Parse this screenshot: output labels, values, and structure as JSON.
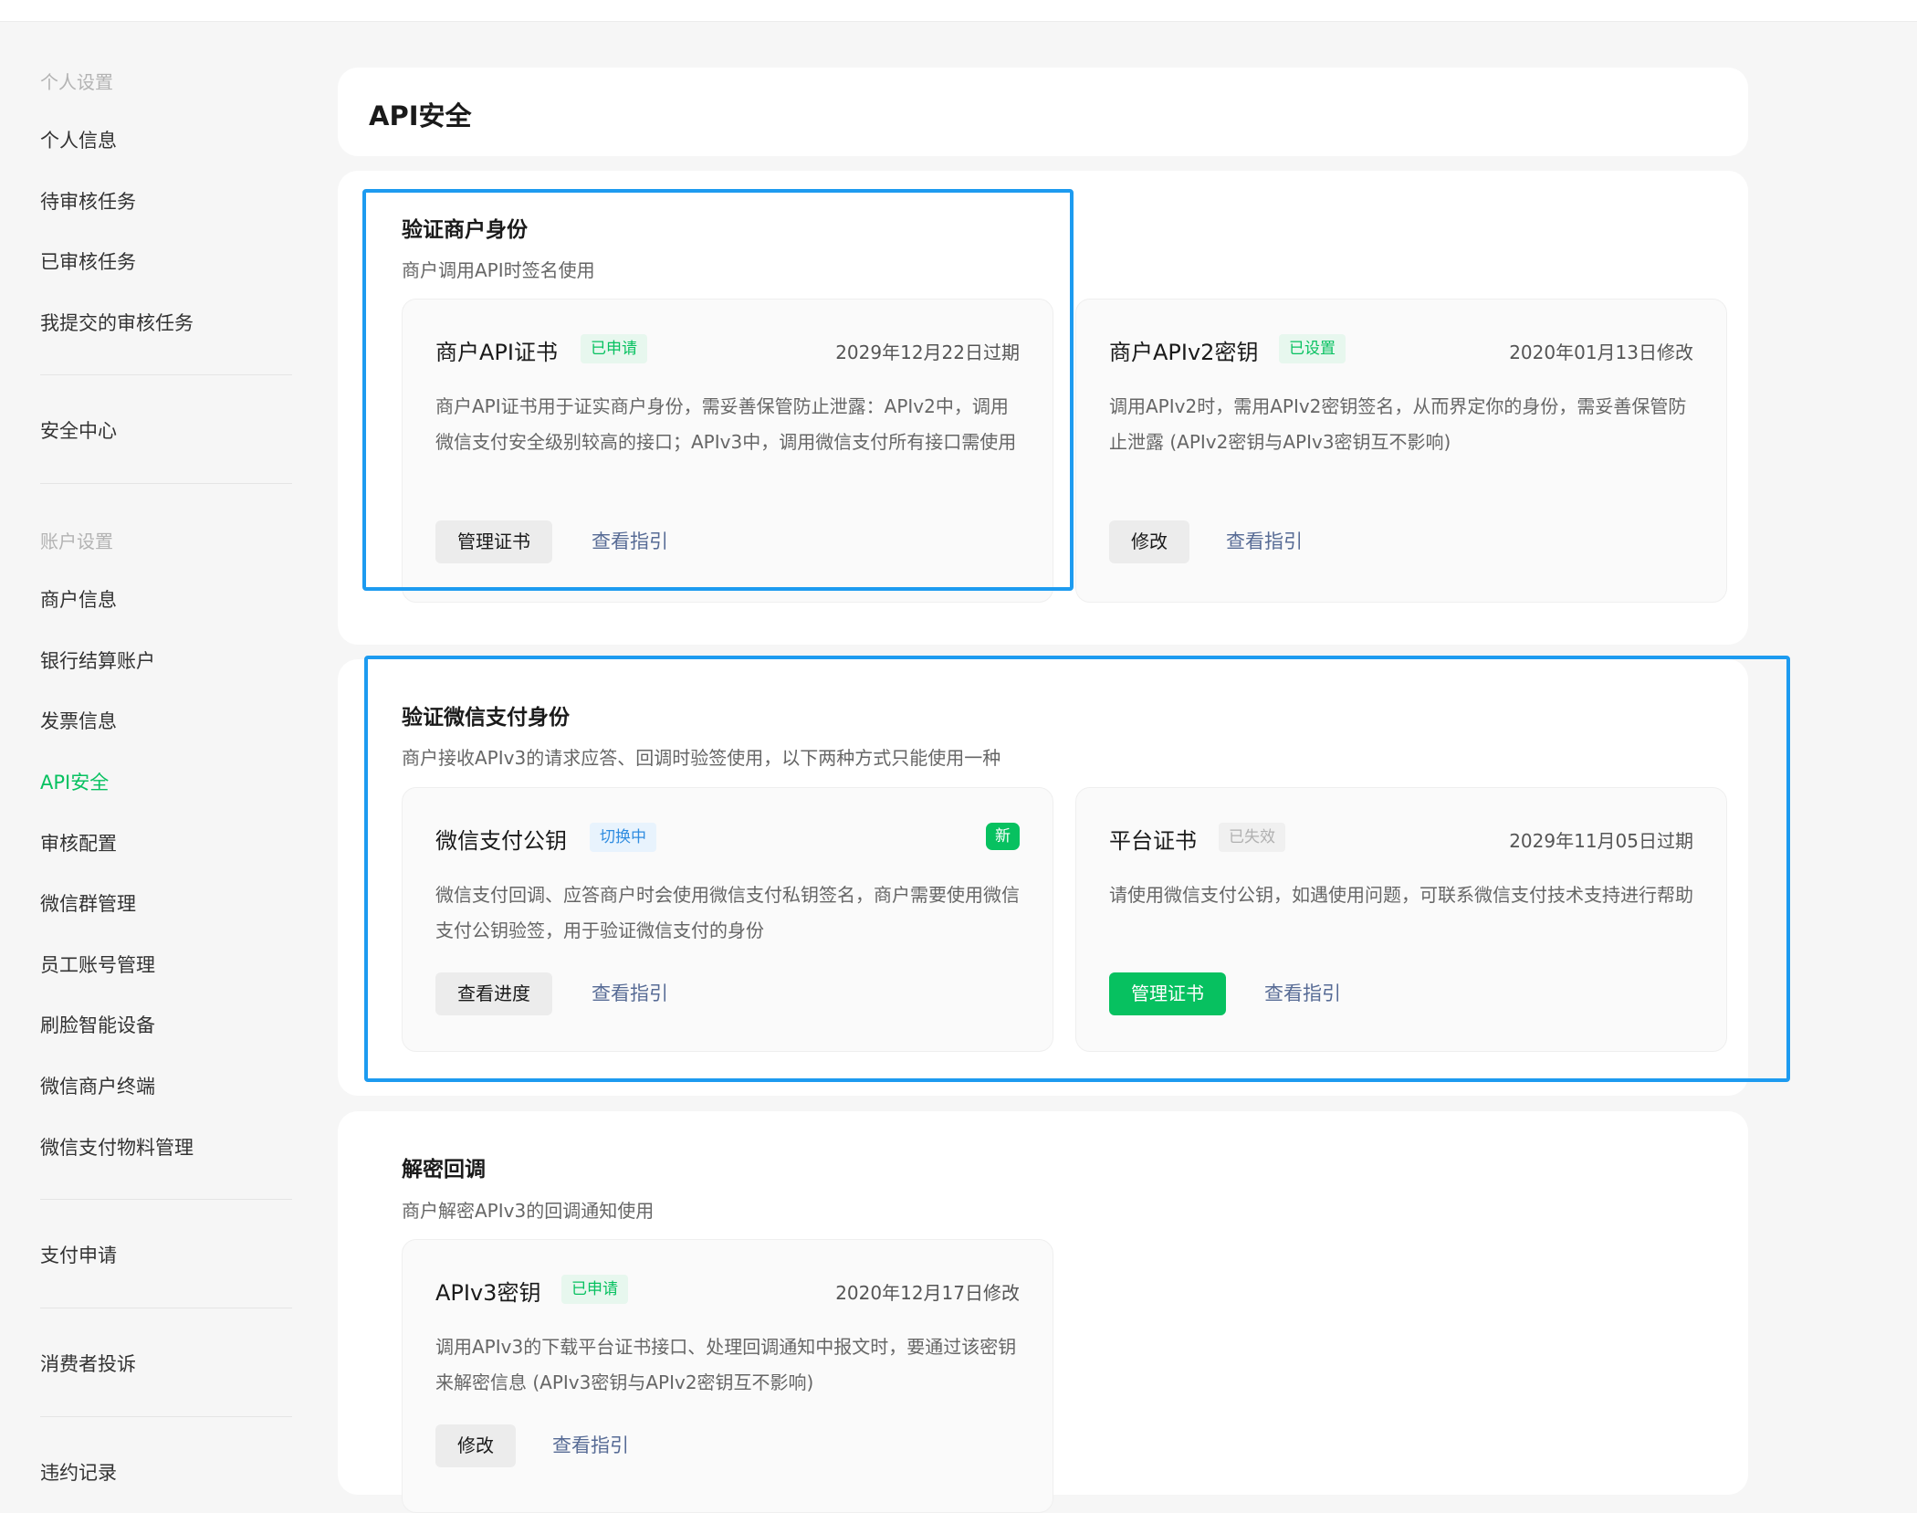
{
  "sidebar": {
    "sections": [
      {
        "title": "个人设置",
        "items": [
          "个人信息",
          "待审核任务",
          "已审核任务",
          "我提交的审核任务"
        ]
      },
      {
        "items": [
          "安全中心"
        ]
      },
      {
        "title": "账户设置",
        "items": [
          "商户信息",
          "银行结算账户",
          "发票信息",
          "API安全",
          "审核配置",
          "微信群管理",
          "员工账号管理",
          "刷脸智能设备",
          "微信商户终端",
          "微信支付物料管理"
        ]
      },
      {
        "items": [
          "支付申请"
        ]
      },
      {
        "items": [
          "消费者投诉"
        ]
      },
      {
        "items": [
          "违约记录"
        ]
      }
    ],
    "active_item": "API安全"
  },
  "page": {
    "title": "API安全"
  },
  "merchant_identity": {
    "title": "验证商户身份",
    "subtitle": "商户调用API时签名使用",
    "cards": [
      {
        "title": "商户API证书",
        "tag": "已申请",
        "meta": "2029年12月22日过期",
        "desc": "商户API证书用于证实商户身份，需妥善保管防止泄露：APIv2中，调用微信支付安全级别较高的接口；APIv3中，调用微信支付所有接口需使用",
        "button": "管理证书",
        "link": "查看指引"
      },
      {
        "title": "商户APIv2密钥",
        "tag": "已设置",
        "meta": "2020年01月13日修改",
        "desc": "调用APIv2时，需用APIv2密钥签名，从而界定你的身份，需妥善保管防止泄露 (APIv2密钥与APIv3密钥互不影响)",
        "button": "修改",
        "link": "查看指引"
      }
    ]
  },
  "wechatpay_identity": {
    "title": "验证微信支付身份",
    "subtitle": "商户接收APIv3的请求应答、回调时验签使用，以下两种方式只能使用一种",
    "cards": [
      {
        "title": "微信支付公钥",
        "tag": "切换中",
        "badge": "新",
        "desc": "微信支付回调、应答商户时会使用微信支付私钥签名，商户需要使用微信支付公钥验签，用于验证微信支付的身份",
        "button": "查看进度",
        "link": "查看指引"
      },
      {
        "title": "平台证书",
        "tag": "已失效",
        "meta": "2029年11月05日过期",
        "desc": "请使用微信支付公钥，如遇使用问题，可联系微信支付技术支持进行帮助",
        "button": "管理证书",
        "link": "查看指引"
      }
    ]
  },
  "decrypt_callback": {
    "title": "解密回调",
    "subtitle": "商户解密APIv3的回调通知使用",
    "cards": [
      {
        "title": "APIv3密钥",
        "tag": "已申请",
        "meta": "2020年12月17日修改",
        "desc": "调用APIv3的下载平台证书接口、处理回调通知中报文时，要通过该密钥来解密信息 (APIv3密钥与APIv2密钥互不影响)",
        "button": "修改",
        "link": "查看指引"
      }
    ]
  },
  "colors": {
    "brand_green": "#07c160",
    "link": "#576b95",
    "highlight": "#1d9bf0"
  }
}
